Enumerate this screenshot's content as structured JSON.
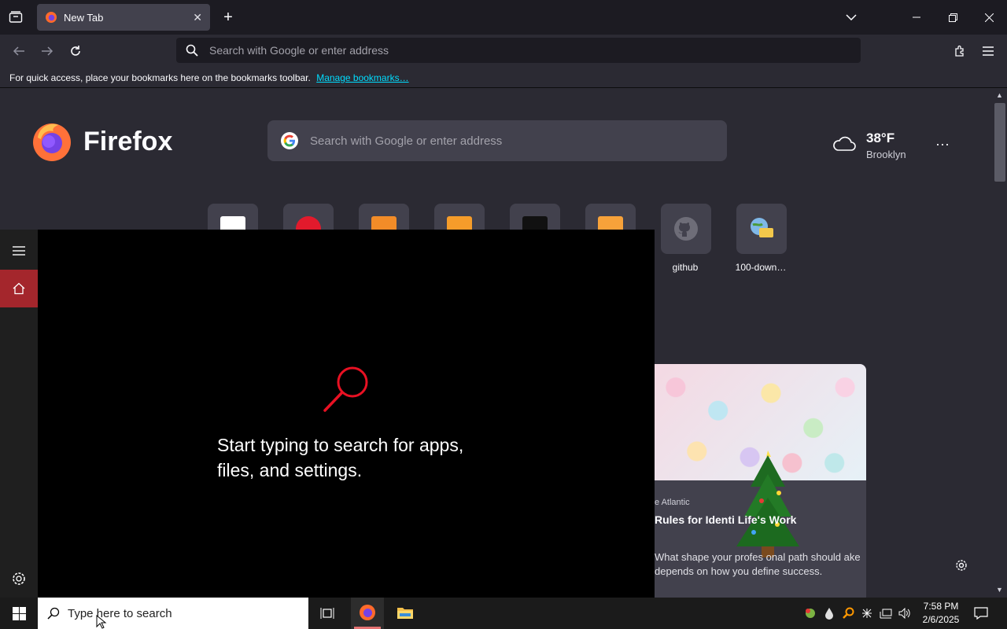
{
  "browser": {
    "tab": {
      "title": "New Tab"
    },
    "urlbar": {
      "placeholder": "Search with Google or enter address"
    },
    "bookmarks_bar": {
      "message": "For quick access, place your bookmarks here on the bookmarks toolbar.",
      "link": "Manage bookmarks…"
    }
  },
  "newtab": {
    "brand": "Firefox",
    "search_placeholder": "Search with Google or enter address",
    "weather": {
      "temp": "38°F",
      "location": "Brooklyn"
    },
    "top_sites": [
      {
        "label": "github",
        "icon": "github-icon"
      },
      {
        "label": "100-down…",
        "icon": "globe-folder-icon"
      }
    ],
    "story": {
      "source": "e Atlantic",
      "title": " Rules for Identi         Life's Work",
      "description": "What shape your profes   onal path should ake depends on how you define success."
    }
  },
  "start_search": {
    "message": "Start typing to search for apps, files, and settings."
  },
  "taskbar": {
    "search_placeholder": "Type here to search",
    "time": "7:58 PM",
    "date": "2/6/2025"
  },
  "colors": {
    "accent": "#a4262c",
    "link": "#00ddff",
    "panel_bg": "#000000",
    "page_bg": "#2b2a33"
  }
}
